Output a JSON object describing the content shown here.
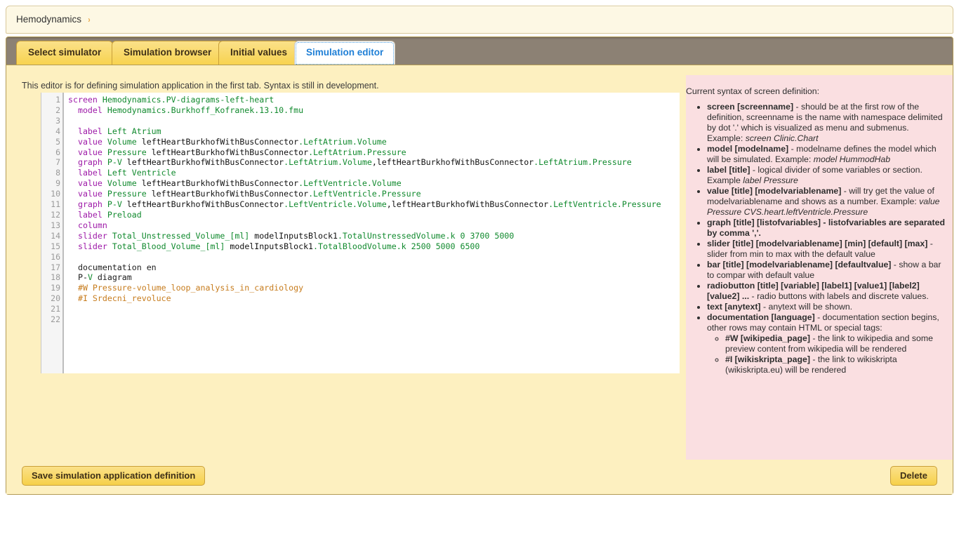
{
  "breadcrumb": {
    "label": "Hemodynamics",
    "arrow": "›",
    "arrow_icon": "chevron-right-icon"
  },
  "tabs": [
    {
      "label": "Select simulator",
      "active": false
    },
    {
      "label": "Simulation browser",
      "active": false
    },
    {
      "label": "Initial values",
      "active": false
    },
    {
      "label": "Simulation editor",
      "active": true
    }
  ],
  "editor": {
    "hint": "This editor is for defining simulation application in the first tab. Syntax is still in development.",
    "line_numbers": [
      1,
      2,
      3,
      4,
      5,
      6,
      7,
      8,
      9,
      10,
      11,
      12,
      13,
      14,
      15,
      16,
      17,
      18,
      19,
      20,
      21,
      22
    ],
    "total_lines": 22,
    "source": "screen Hemodynamics.PV-diagrams-left-heart\n  model Hemodynamics.Burkhoff_Kofranek.13.10.fmu\n\n  label Left Atrium\n  value Volume leftHeartBurkhofWithBusConnector.LeftAtrium.Volume\n  value Pressure leftHeartBurkhofWithBusConnector.LeftAtrium.Pressure\n  graph P-V leftHeartBurkhofWithBusConnector.LeftAtrium.Volume,leftHeartBurkhofWithBusConnector.LeftAtrium.Pressure\n  label Left Ventricle\n  value Volume leftHeartBurkhofWithBusConnector.LeftVentricle.Volume\n  value Pressure leftHeartBurkhofWithBusConnector.LeftVentricle.Pressure\n  graph P-V leftHeartBurkhofWithBusConnector.LeftVentricle.Volume,leftHeartBurkhofWithBusConnector.LeftVentricle.Pressure\n  label Preload\n  column\n  slider Total_Unstressed_Volume_[ml] modelInputsBlock1.TotalUnstressedVolume.k 0 3700 5000\n  slider Total_Blood_Volume_[ml] modelInputsBlock1.TotalBloodVolume.k 2500 5000 6500\n\n  documentation en\n  P-V diagram\n  #W Pressure-volume_loop_analysis_in_cardiology\n  #I Srdecni_revoluce\n\n"
  },
  "docs": {
    "intro": "Current syntax of screen definition:",
    "items": [
      {
        "term": "screen [screenname]",
        "rest": " - should be at the first row of the definition, screenname is the name with namespace delimited by dot '.' which is visualized as menu and submenus. Example: ",
        "em": "screen Clinic.Chart"
      },
      {
        "term": "model [modelname]",
        "rest": " - modelname defines the model which will be simulated. Example: ",
        "em": "model HummodHab"
      },
      {
        "term": "label [title]",
        "rest": " - logical divider of some variables or section. Example ",
        "em": "label Pressure"
      },
      {
        "term": "value [title] [modelvariablename]",
        "rest": " - will try get the value of modelvariablename and shows as a number. Example: ",
        "em": "value Pressure CVS.heart.leftVentricle.Pressure"
      },
      {
        "all_bold": "graph [title] [listofvariables] - listofvariables are separated by comma ','."
      },
      {
        "term": "slider [title] [modelvariablename] [min] [default] [max]",
        "rest": " - slider from min to max with the default value",
        "em": ""
      },
      {
        "term": "bar [title] [modelvariablename] [defaultvalue]",
        "rest": " - show a bar to compar with default value",
        "em": ""
      },
      {
        "term": "radiobutton [title] [variable] [label1] [value1] [label2] [value2] ...",
        "rest": " - radio buttons with labels and discrete values.",
        "em": ""
      },
      {
        "term": "text [anytext]",
        "rest": " - anytext will be shown.",
        "em": ""
      },
      {
        "term": "documentation [language]",
        "rest": " - documentation section begins, other rows may contain HTML or special tags:",
        "em": "",
        "subitems": [
          {
            "term": "#W [wikipedia_page]",
            "rest": " - the link to wikipedia and some preview content from wikipedia will be rendered"
          },
          {
            "term": "#I [wikiskripta_page]",
            "rest": " - the link to wikiskripta (wikiskripta.eu) will be rendered"
          }
        ]
      }
    ]
  },
  "footer": {
    "save_label": "Save simulation application definition",
    "delete_label": "Delete"
  },
  "colors": {
    "panel_bg": "#fdf0c0",
    "tabstrip_bg": "#8c8174",
    "tab_bg": "#f7d24c",
    "tab_active_text": "#1f7fd6",
    "docs_bg": "#fadfe1",
    "keyword": "#9e1aa8",
    "green": "#118a2e",
    "comment": "#c77c1d",
    "breadcrumb_arrow": "#e8a33d"
  }
}
